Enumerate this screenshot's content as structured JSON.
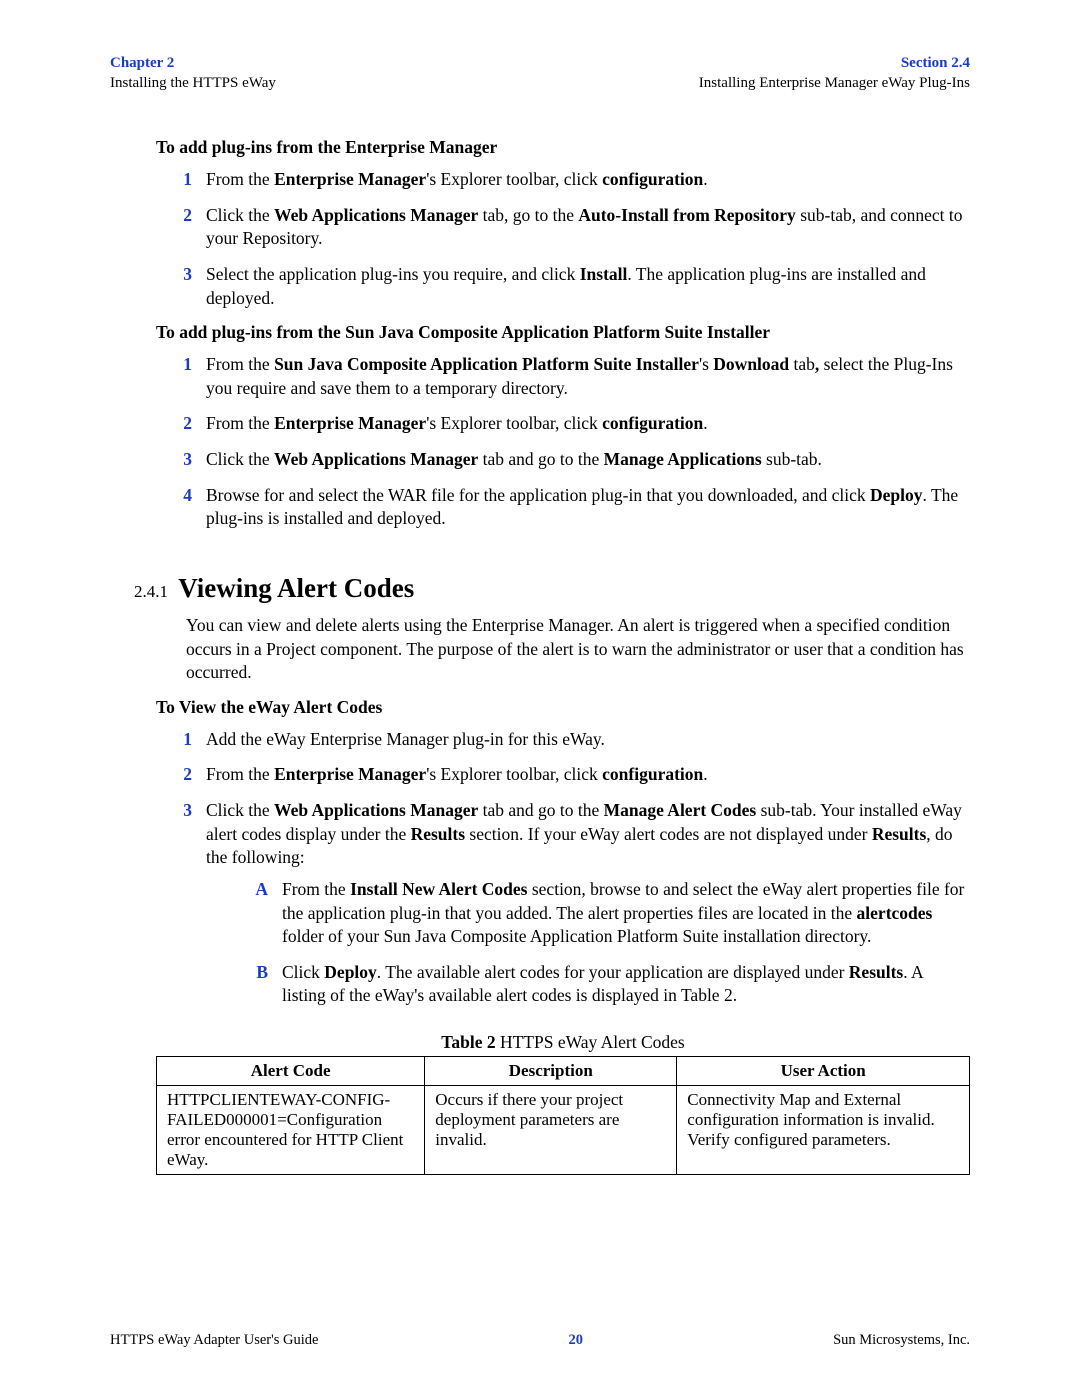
{
  "header": {
    "chapter": "Chapter 2",
    "chapter_sub": "Installing the HTTPS eWay",
    "section": "Section 2.4",
    "section_sub": "Installing Enterprise Manager eWay Plug-Ins"
  },
  "h1": "To add plug-ins from the Enterprise Manager",
  "list1": {
    "n1": "1",
    "t1a": "From the ",
    "t1b": "Enterprise Manager",
    "t1c": "'s Explorer toolbar, click ",
    "t1d": "configuration",
    "t1e": ".",
    "n2": "2",
    "t2a": "Click the ",
    "t2b": "Web Applications Manager",
    "t2c": " tab, go to the ",
    "t2d": "Auto-Install from Repository",
    "t2e": " sub-tab, and connect to your Repository.",
    "n3": "3",
    "t3a": "Select the application plug-ins you require, and click ",
    "t3b": "Install",
    "t3c": ". The application plug-ins are installed and deployed."
  },
  "h2": "To add plug-ins from the Sun Java Composite Application Platform Suite Installer",
  "list2": {
    "n1": "1",
    "t1a": "From the ",
    "t1b": "Sun Java Composite Application Platform Suite Installer",
    "t1c": "'s ",
    "t1d": "Download",
    "t1e": " tab",
    "t1f": ",",
    "t1g": " select the Plug-Ins you require and save them to a temporary directory.",
    "n2": "2",
    "t2a": "From the ",
    "t2b": "Enterprise Manager",
    "t2c": "'s Explorer toolbar, click ",
    "t2d": "configuration",
    "t2e": ".",
    "n3": "3",
    "t3a": "Click the ",
    "t3b": "Web Applications Manager",
    "t3c": " tab and go to the ",
    "t3d": "Manage Applications",
    "t3e": " sub-tab.",
    "n4": "4",
    "t4a": "Browse for and select the WAR file for the application plug-in that you downloaded, and click ",
    "t4b": "Deploy",
    "t4c": ". The plug-ins is installed and deployed."
  },
  "secnum": "2.4.1",
  "sectitle": "Viewing Alert Codes",
  "para1": "You can view and delete alerts using the Enterprise Manager. An alert is triggered when a specified condition occurs in a Project component. The purpose of the alert is to warn the administrator or user that a condition has occurred.",
  "h3": "To View the eWay Alert Codes",
  "list3": {
    "n1": "1",
    "t1": "Add the eWay Enterprise Manager plug-in for this eWay.",
    "n2": "2",
    "t2a": "From the ",
    "t2b": "Enterprise Manager",
    "t2c": "'s Explorer toolbar, click ",
    "t2d": "configuration",
    "t2e": ".",
    "n3": "3",
    "t3a": "Click the ",
    "t3b": "Web Applications Manager",
    "t3c": " tab and go to the ",
    "t3d": "Manage Alert Codes",
    "t3e": " sub-tab. Your installed eWay alert codes display under the ",
    "t3f": "Results",
    "t3g": " section. If your eWay alert codes are not displayed under ",
    "t3h": "Results",
    "t3i": ", do the following:"
  },
  "list4": {
    "nA": "A",
    "tAa": "From the ",
    "tAb": "Install New Alert Codes",
    "tAc": " section, browse to and select the eWay alert properties file for the application plug-in that you added. The alert properties files are located in the ",
    "tAd": "alertcodes",
    "tAe": " folder of your Sun Java Composite Application Platform Suite installation directory.",
    "nB": "B",
    "tBa": "Click ",
    "tBb": "Deploy",
    "tBc": ". The available alert codes for your application are displayed under ",
    "tBd": "Results",
    "tBe": ". A listing of the eWay's available alert codes is displayed in Table 2."
  },
  "table": {
    "caption_b": "Table 2",
    "caption_r": "   HTTPS eWay Alert Codes",
    "h1": "Alert Code",
    "h2": "Description",
    "h3": "User Action",
    "c1": "HTTPCLIENTEWAY-CONFIG-FAILED000001=Configuration error encountered for HTTP Client eWay.",
    "c2": "Occurs if there your project deployment parameters are invalid.",
    "c3": "Connectivity Map and External configuration information is invalid. Verify configured parameters."
  },
  "footer": {
    "left": "HTTPS eWay Adapter User's Guide",
    "page": "20",
    "right": "Sun Microsystems, Inc."
  }
}
